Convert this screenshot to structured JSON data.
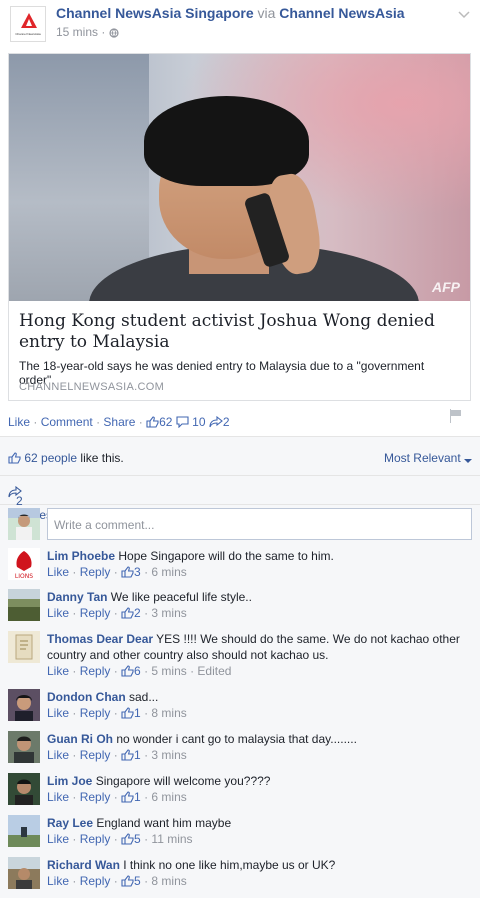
{
  "post": {
    "page_name": "Channel NewsAsia Singapore",
    "via": "via",
    "via_page": "Channel NewsAsia",
    "logo_text": "Channel NewsAsia",
    "time": "15 mins",
    "time_sep": "·",
    "audience_icon": "globe-icon",
    "menu_icon": "chevron-down-icon",
    "link": {
      "image_credit": "AFP",
      "title": "Hong Kong student activist Joshua Wong denied entry to Malaysia",
      "description": "The 18-year-old says he was denied entry to Malaysia due to a \"government order\".",
      "domain": "CHANNELNEWSASIA.COM"
    },
    "actions": {
      "like": "Like",
      "comment": "Comment",
      "share": "Share",
      "like_count": "62",
      "comment_count": "10",
      "share_count": "2"
    }
  },
  "likes_bar": {
    "count_text": "62 people",
    "suffix": "like this.",
    "sort_label": "Most Relevant"
  },
  "shares_bar": {
    "label": "2 shares"
  },
  "composer": {
    "placeholder": "Write a comment..."
  },
  "comment_meta": {
    "like": "Like",
    "reply": "Reply"
  },
  "comments": [
    {
      "name": "Lim Phoebe",
      "text": "Hope Singapore will do the same to him.",
      "likes": "3",
      "time": "6 mins",
      "edited": ""
    },
    {
      "name": "Danny Tan",
      "text": "We like peaceful life style..",
      "likes": "2",
      "time": "3 mins",
      "edited": ""
    },
    {
      "name": "Thomas Dear Dear",
      "text": "YES !!!! We should do the same. We do not kachao other country and other country also should not kachao us.",
      "likes": "6",
      "time": "5 mins",
      "edited": "Edited"
    },
    {
      "name": "Dondon Chan",
      "text": "sad...",
      "likes": "1",
      "time": "8 mins",
      "edited": ""
    },
    {
      "name": "Guan Ri Oh",
      "text": "no wonder i cant go to malaysia that day........",
      "likes": "1",
      "time": "3 mins",
      "edited": ""
    },
    {
      "name": "Lim Joe",
      "text": "Singapore will welcome you????",
      "likes": "1",
      "time": "6 mins",
      "edited": ""
    },
    {
      "name": "Ray Lee",
      "text": "England want him maybe",
      "likes": "5",
      "time": "11 mins",
      "edited": ""
    },
    {
      "name": "Richard Wan",
      "text": "I think no one like him,maybe us or UK?",
      "likes": "5",
      "time": "8 mins",
      "edited": ""
    }
  ],
  "colors": {
    "link": "#365899",
    "action": "#4267b2",
    "muted": "#90949c",
    "brand_red": "#e0262a"
  }
}
